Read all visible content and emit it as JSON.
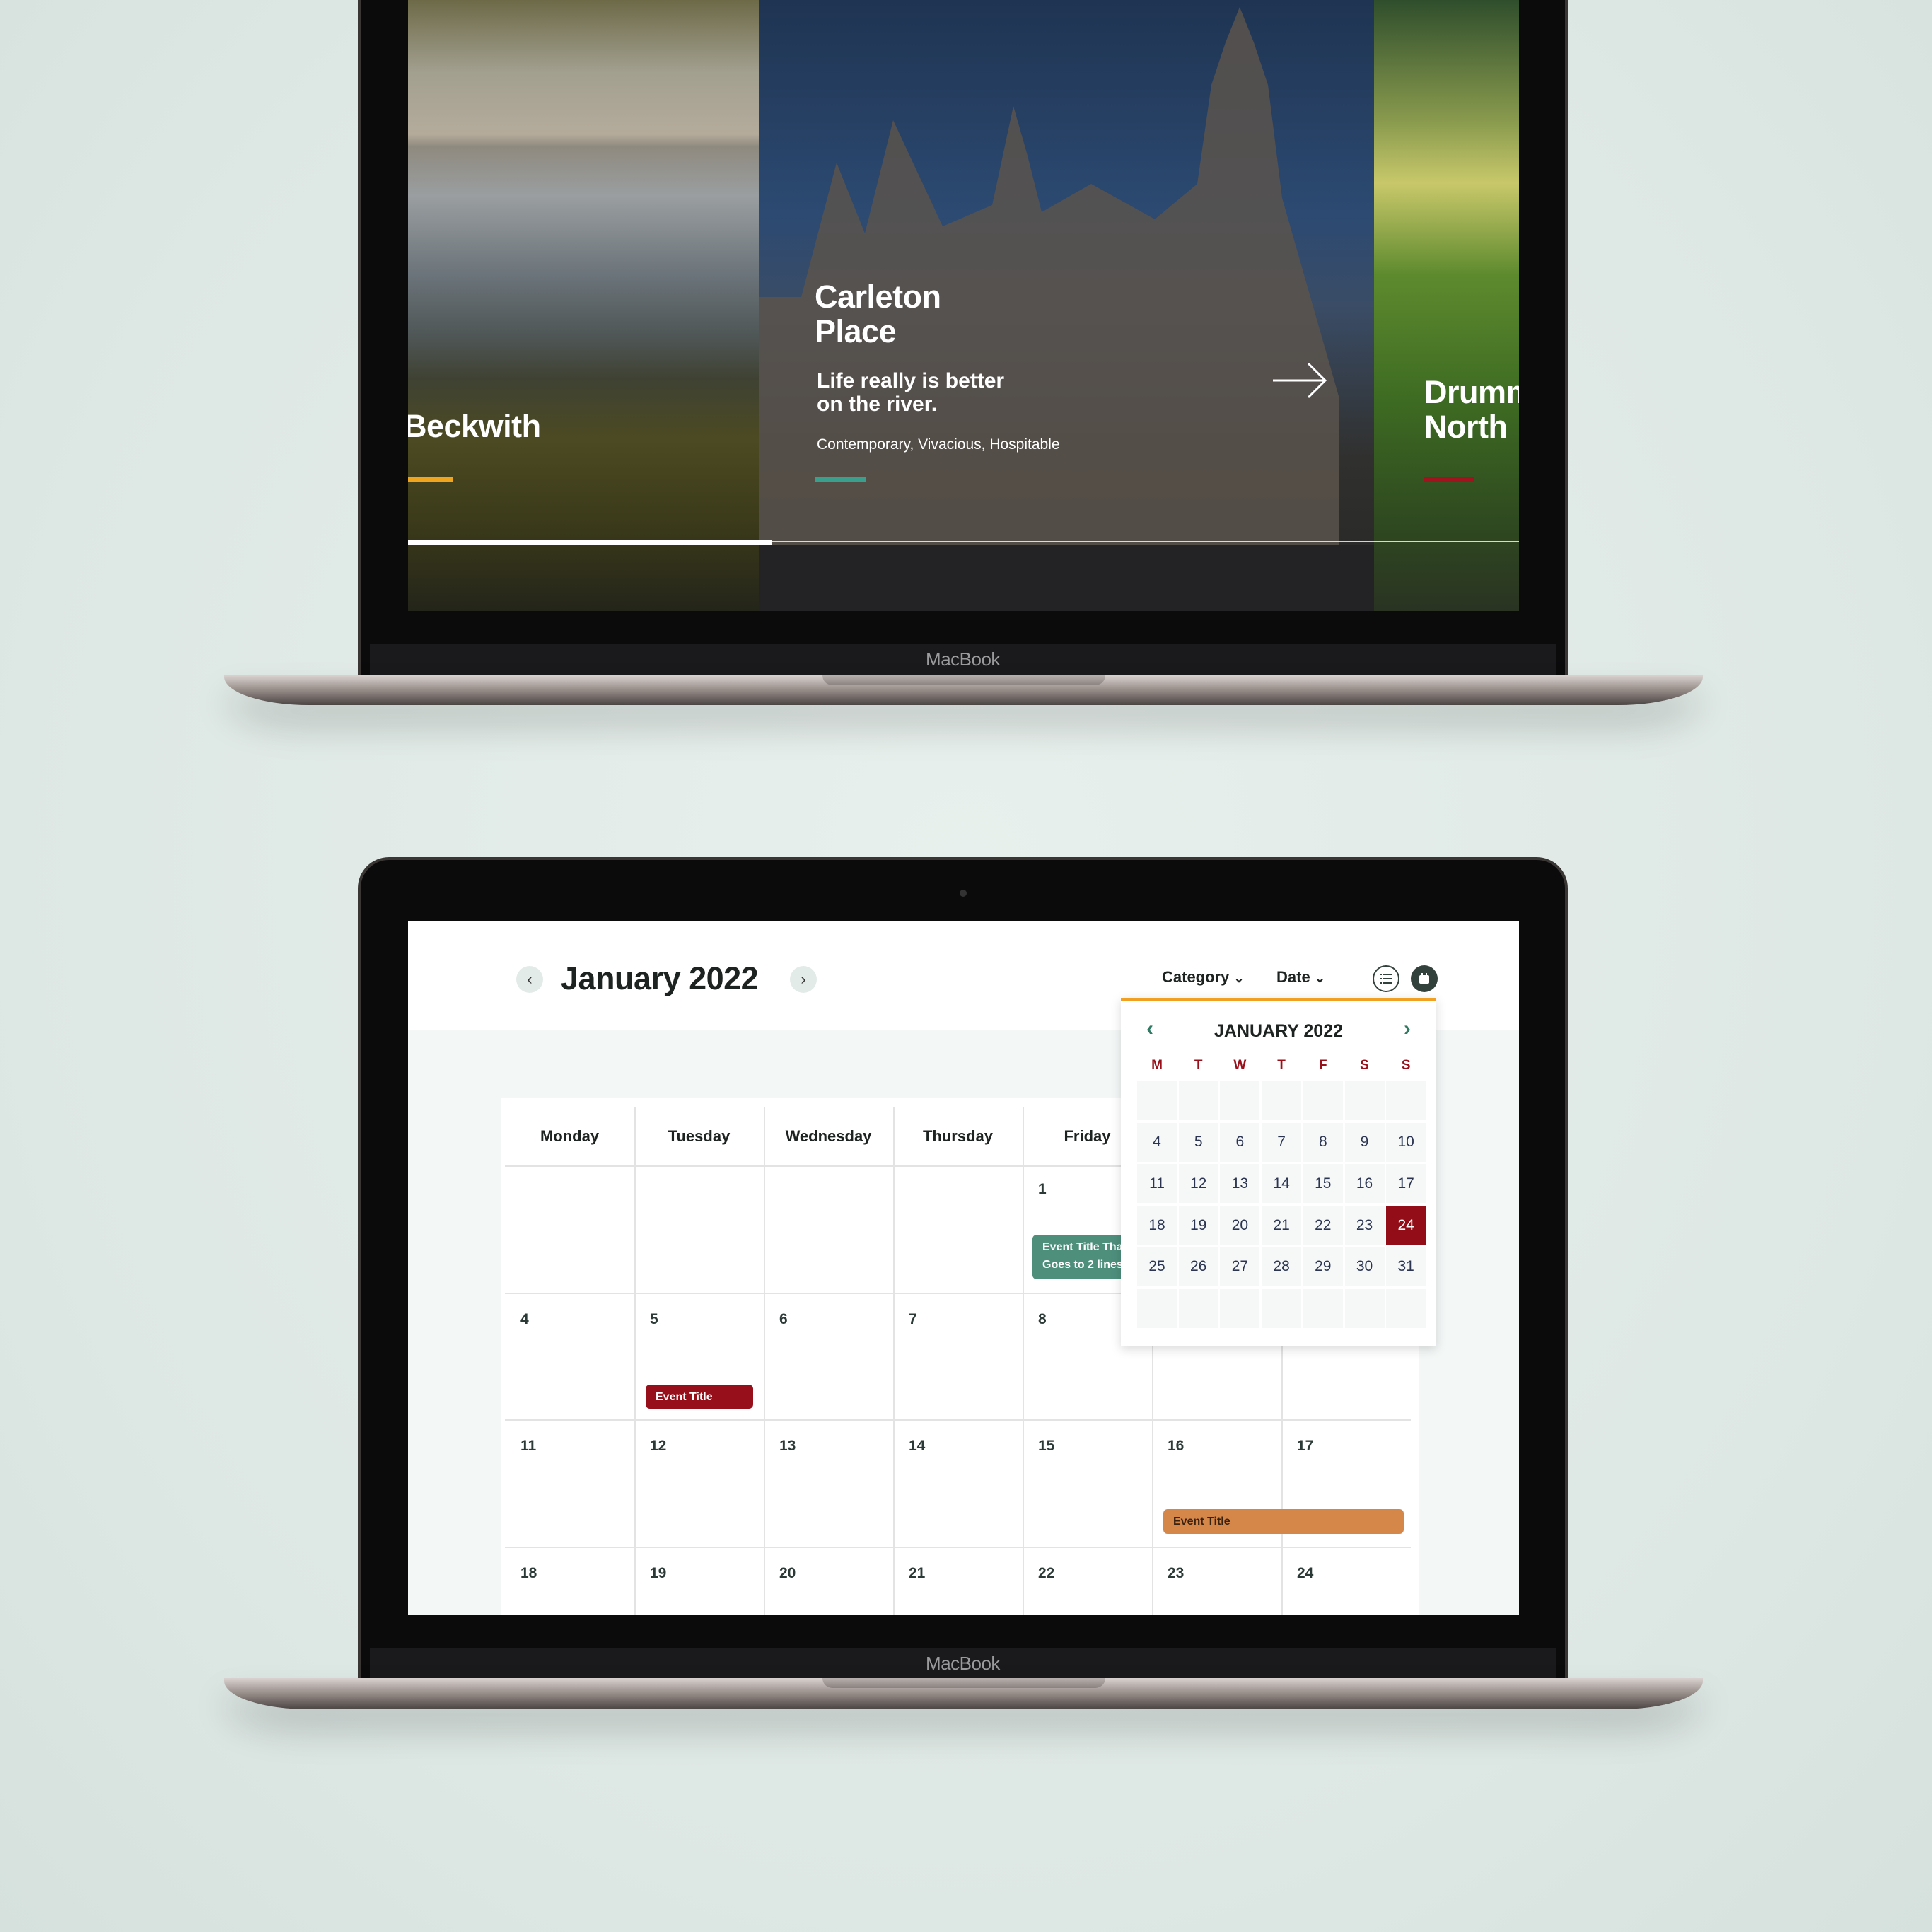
{
  "device_label": "MacBook",
  "hero": {
    "slides": [
      {
        "title": "Beckwith",
        "accent": "#f0a51e"
      },
      {
        "title": "Carleton Place",
        "title_lines": [
          "Carleton",
          "Place"
        ],
        "subtitle_lines": [
          "Life really is better",
          "on the river."
        ],
        "tags": "Contemporary, Vivacious, Hospitable",
        "accent": "#3aa08d"
      },
      {
        "title_lines": [
          "Drumm",
          "North"
        ],
        "accent": "#a01420"
      }
    ],
    "next_icon": "arrow-right-icon",
    "progress": 0.33
  },
  "calendar": {
    "title": "January 2022",
    "prev_icon": "chevron-left-icon",
    "next_icon": "chevron-right-icon",
    "filters": [
      {
        "label": "Category",
        "icon": "chevron-down-icon"
      },
      {
        "label": "Date",
        "icon": "chevron-down-icon"
      }
    ],
    "view_toggle": [
      {
        "icon": "list-icon",
        "active": false
      },
      {
        "icon": "calendar-icon",
        "active": true
      }
    ],
    "weekdays": [
      "Monday",
      "Tuesday",
      "Wednesday",
      "Thursday",
      "Friday",
      "",
      ""
    ],
    "weeks": [
      [
        "",
        "",
        "",
        "",
        "1",
        "",
        ""
      ],
      [
        "4",
        "5",
        "6",
        "7",
        "8",
        "",
        ""
      ],
      [
        "11",
        "12",
        "13",
        "14",
        "15",
        "16",
        "17"
      ],
      [
        "18",
        "19",
        "20",
        "21",
        "22",
        "23",
        "24"
      ]
    ],
    "events": [
      {
        "title": "Event Title That Goes to 2 lines",
        "lines": [
          "Event Title That",
          "Goes to 2 lines"
        ],
        "color": "#4e8f7c"
      },
      {
        "title": "Event Title",
        "color": "#970f1a"
      },
      {
        "title": "Event Title",
        "color": "#d5874a"
      }
    ]
  },
  "datepicker": {
    "title": "JANUARY 2022",
    "prev_icon": "chevron-left-icon",
    "next_icon": "chevron-right-icon",
    "dow": [
      "M",
      "T",
      "W",
      "T",
      "F",
      "S",
      "S"
    ],
    "rows": [
      [
        "",
        "",
        "",
        "",
        "",
        "",
        ""
      ],
      [
        "4",
        "5",
        "6",
        "7",
        "8",
        "9",
        "10"
      ],
      [
        "11",
        "12",
        "13",
        "14",
        "15",
        "16",
        "17"
      ],
      [
        "18",
        "19",
        "20",
        "21",
        "22",
        "23",
        "24"
      ],
      [
        "25",
        "26",
        "27",
        "28",
        "29",
        "30",
        "31"
      ],
      [
        "",
        "",
        "",
        "",
        "",
        "",
        ""
      ]
    ],
    "selected": "24",
    "selected_color": "#920d17",
    "accent": "#f0a023"
  }
}
